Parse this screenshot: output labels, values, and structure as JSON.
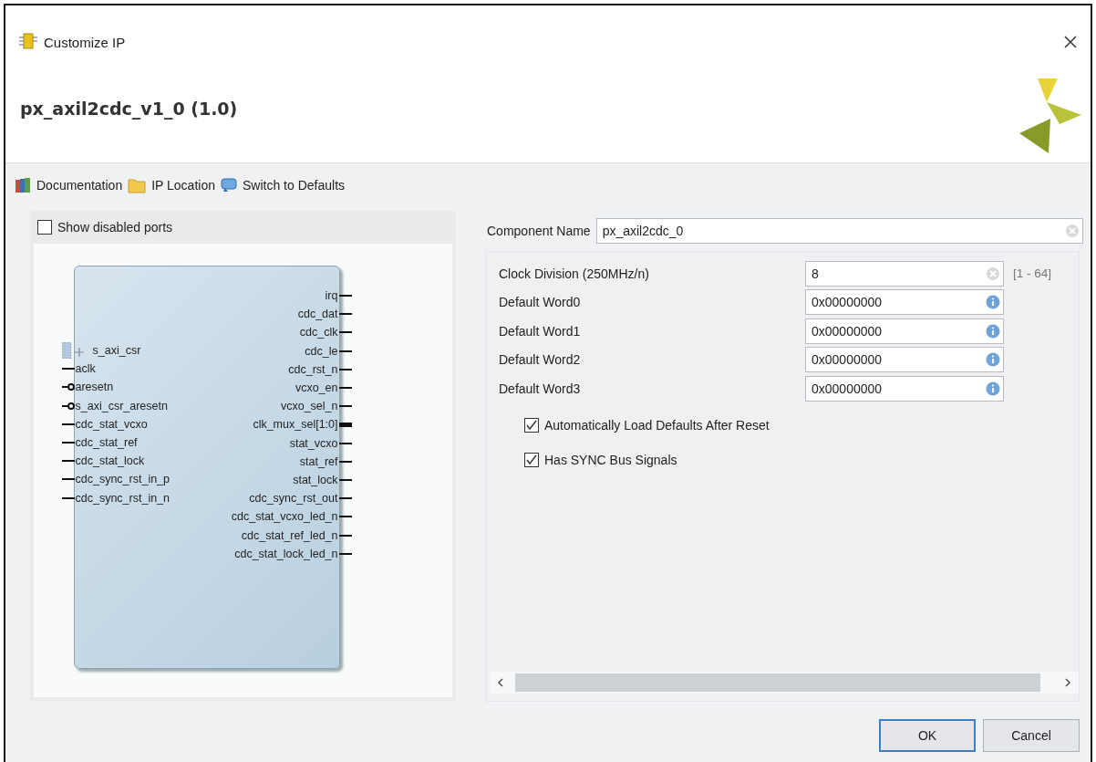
{
  "window": {
    "title": "Customize IP"
  },
  "header": {
    "ip_name": "px_axil2cdc_v1_0 (1.0)"
  },
  "toolbar": [
    {
      "label": "Documentation",
      "kind": "docs"
    },
    {
      "label": "IP Location",
      "kind": "folder"
    },
    {
      "label": "Switch to Defaults",
      "kind": "reset"
    }
  ],
  "symbol_panel": {
    "show_disabled_ports": {
      "label": "Show disabled ports",
      "checked": false
    },
    "left_ports": [
      {
        "name": "s_axi_csr",
        "kind": "bus"
      },
      {
        "name": "aclk",
        "kind": "plain"
      },
      {
        "name": "aresetn",
        "kind": "inverted"
      },
      {
        "name": "s_axi_csr_aresetn",
        "kind": "inverted"
      },
      {
        "name": "cdc_stat_vcxo",
        "kind": "plain"
      },
      {
        "name": "cdc_stat_ref",
        "kind": "plain"
      },
      {
        "name": "cdc_stat_lock",
        "kind": "plain"
      },
      {
        "name": "cdc_sync_rst_in_p",
        "kind": "plain"
      },
      {
        "name": "cdc_sync_rst_in_n",
        "kind": "plain"
      }
    ],
    "right_ports": [
      {
        "name": "irq",
        "kind": "plain"
      },
      {
        "name": "cdc_dat",
        "kind": "plain"
      },
      {
        "name": "cdc_clk",
        "kind": "plain"
      },
      {
        "name": "cdc_le",
        "kind": "plain"
      },
      {
        "name": "cdc_rst_n",
        "kind": "plain"
      },
      {
        "name": "vcxo_en",
        "kind": "plain"
      },
      {
        "name": "vcxo_sel_n",
        "kind": "plain"
      },
      {
        "name": "clk_mux_sel[1:0]",
        "kind": "vector"
      },
      {
        "name": "stat_vcxo",
        "kind": "plain"
      },
      {
        "name": "stat_ref",
        "kind": "plain"
      },
      {
        "name": "stat_lock",
        "kind": "plain"
      },
      {
        "name": "cdc_sync_rst_out",
        "kind": "plain"
      },
      {
        "name": "cdc_stat_vcxo_led_n",
        "kind": "plain"
      },
      {
        "name": "cdc_stat_ref_led_n",
        "kind": "plain"
      },
      {
        "name": "cdc_stat_lock_led_n",
        "kind": "plain"
      }
    ]
  },
  "settings": {
    "component_name": {
      "label": "Component Name",
      "value": "px_axil2cdc_0"
    },
    "params": [
      {
        "label": "Clock Division (250MHz/n)",
        "value": "8",
        "kind": "clearable",
        "range": "[1 - 64]"
      },
      {
        "label": "Default Word0",
        "value": "0x00000000",
        "kind": "info"
      },
      {
        "label": "Default Word1",
        "value": "0x00000000",
        "kind": "info"
      },
      {
        "label": "Default Word2",
        "value": "0x00000000",
        "kind": "info"
      },
      {
        "label": "Default Word3",
        "value": "0x00000000",
        "kind": "info"
      }
    ],
    "options": [
      {
        "label": "Automatically Load Defaults After Reset",
        "checked": true
      },
      {
        "label": "Has SYNC Bus Signals",
        "checked": true
      }
    ]
  },
  "buttons": [
    {
      "label": "OK",
      "default": true
    },
    {
      "label": "Cancel",
      "default": false
    }
  ]
}
